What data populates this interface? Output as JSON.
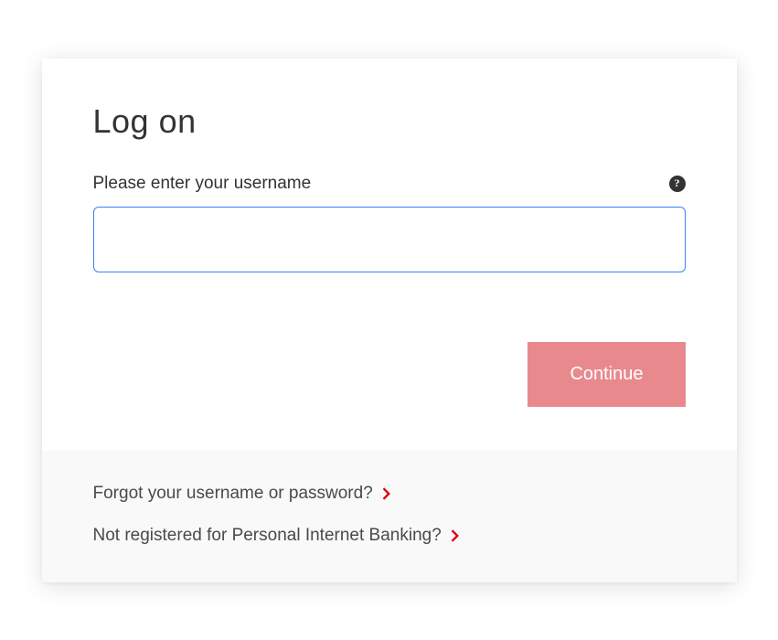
{
  "title": "Log on",
  "username": {
    "label": "Please enter your username",
    "value": ""
  },
  "buttons": {
    "continue": "Continue"
  },
  "footer": {
    "forgot": "Forgot your username or password?",
    "register": "Not registered for Personal Internet Banking?"
  },
  "colors": {
    "accent": "#E88A8D",
    "chevron": "#DB0011",
    "focus": "#3B82F6"
  }
}
